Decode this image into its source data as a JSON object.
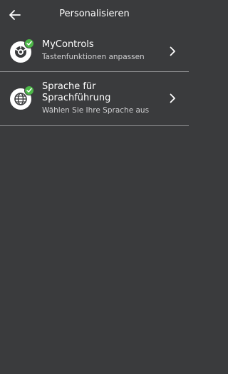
{
  "header": {
    "title": "Personalisieren",
    "back_icon": "arrow-left-icon"
  },
  "items": [
    {
      "title": "MyControls",
      "subtitle": "Tastenfunktionen anpassen",
      "icon": "hearing-aid-settings-icon",
      "badge": "check-icon"
    },
    {
      "title_line1": "Sprache für",
      "title_line2": "Sprachführung",
      "subtitle": "Wählen Sie Ihre Sprache aus",
      "icon": "globe-icon",
      "badge": "check-icon"
    }
  ],
  "colors": {
    "background": "#3a3b3d",
    "divider": "#8b8c8e",
    "badge": "#4cb748",
    "text_primary": "#ffffff",
    "text_secondary": "#d0d0d2"
  }
}
